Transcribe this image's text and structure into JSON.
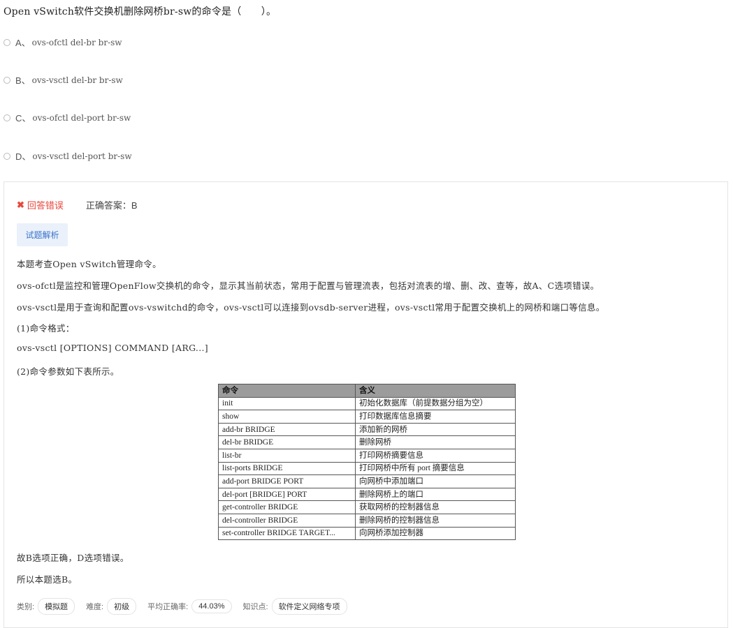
{
  "question": {
    "title": "Open vSwitch软件交换机删除网桥br-sw的命令是（　　）。",
    "options": [
      {
        "letter": "A、",
        "text": "ovs-ofctl del-br br-sw"
      },
      {
        "letter": "B、",
        "text": "ovs-vsctl del-br br-sw"
      },
      {
        "letter": "C、",
        "text": "ovs-ofctl del-port br-sw"
      },
      {
        "letter": "D、",
        "text": "ovs-vsctl del-port br-sw"
      }
    ]
  },
  "result": {
    "wrong_icon": "✖",
    "wrong_text": "回答错误",
    "correct_answer": "正确答案：B"
  },
  "analysis": {
    "button_label": "试题解析",
    "paragraphs": [
      "本题考查Open vSwitch管理命令。",
      "ovs-ofctl是监控和管理OpenFlow交换机的命令，显示其当前状态，常用于配置与管理流表，包括对流表的增、删、改、查等，故A、C选项错误。",
      "ovs-vsctl是用于查询和配置ovs-vswitchd的命令，ovs-vsctl可以连接到ovsdb-server进程，ovs-vsctl常用于配置交换机上的网桥和端口等信息。",
      "(1)命令格式：",
      "ovs-vsctl [OPTIONS] COMMAND [ARG...]",
      "(2)命令参数如下表所示。"
    ],
    "table": {
      "headers": [
        "命令",
        "含义"
      ],
      "rows": [
        [
          "init",
          "初始化数据库（前提数据分组为空）"
        ],
        [
          "show",
          "打印数据库信息摘要"
        ],
        [
          "add-br BRIDGE",
          "添加新的网桥"
        ],
        [
          "del-br BRIDGE",
          "删除网桥"
        ],
        [
          "list-br",
          "打印网桥摘要信息"
        ],
        [
          "list-ports BRIDGE",
          "打印网桥中所有 port 摘要信息"
        ],
        [
          "add-port BRIDGE PORT",
          "向网桥中添加端口"
        ],
        [
          "del-port [BRIDGE] PORT",
          "删除网桥上的端口"
        ],
        [
          "get-controller BRIDGE",
          "获取网桥的控制器信息"
        ],
        [
          "del-controller BRIDGE",
          "删除网桥的控制器信息"
        ],
        [
          "set-controller BRIDGE TARGET...",
          "向网桥添加控制器"
        ]
      ]
    },
    "conclusion": [
      "故B选项正确，D选项错误。",
      "所以本题选B。"
    ]
  },
  "meta": {
    "category_label": "类别:",
    "category": "模拟题",
    "difficulty_label": "难度:",
    "difficulty": "初级",
    "accuracy_label": "平均正确率:",
    "accuracy": "44.03%",
    "knowledge_label": "知识点:",
    "knowledge": "软件定义网络专项"
  }
}
